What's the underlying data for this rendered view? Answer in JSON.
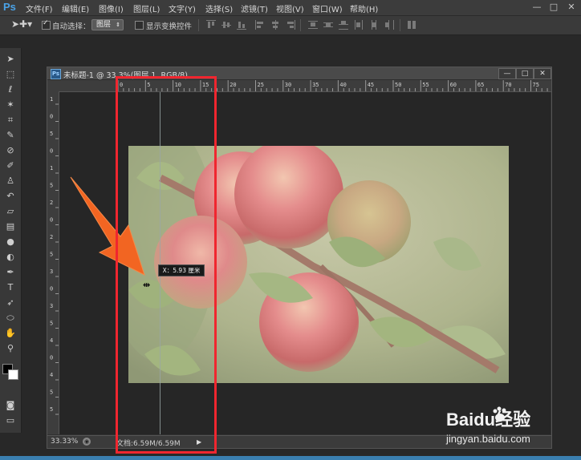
{
  "app": {
    "logo": "Ps",
    "menu": [
      "文件(F)",
      "编辑(E)",
      "图像(I)",
      "图层(L)",
      "文字(Y)",
      "选择(S)",
      "滤镜(T)",
      "视图(V)",
      "窗口(W)",
      "帮助(H)"
    ],
    "window_controls": [
      "—",
      "□",
      "✕"
    ]
  },
  "options": {
    "auto_select_label": "自动选择：",
    "auto_select_checked": true,
    "auto_select_value": "图层",
    "show_transform_label": "显示变换控件",
    "show_transform_checked": false
  },
  "tools": [
    "move-tool",
    "marquee-tool",
    "lasso-tool",
    "magic-wand-tool",
    "crop-tool",
    "eyedropper-tool",
    "spot-heal-tool",
    "brush-tool",
    "clone-stamp-tool",
    "history-brush-tool",
    "eraser-tool",
    "gradient-tool",
    "blur-tool",
    "dodge-tool",
    "pen-tool",
    "type-tool",
    "path-select-tool",
    "shape-tool",
    "hand-tool",
    "zoom-tool"
  ],
  "document": {
    "icon": "Ps",
    "title": "未标题-1 @ 33.3%(图层 1, RGB/8)",
    "controls": [
      "—",
      "□",
      "✕"
    ],
    "ruler_top": [
      "0",
      "5",
      "10",
      "15",
      "20",
      "25",
      "30",
      "35",
      "40",
      "45",
      "50",
      "55",
      "60",
      "65",
      "70",
      "75"
    ],
    "ruler_left": [
      "1",
      "0",
      "5",
      "0",
      "1",
      "5",
      "2",
      "0",
      "2",
      "5",
      "3",
      "0",
      "3",
      "5",
      "4",
      "0",
      "4",
      "5",
      "5"
    ],
    "zoom": "33.33%",
    "doc_size": "文档:6.59M/6.59M",
    "guide_tooltip": "X：5.93 厘米"
  },
  "watermark": {
    "brand": "Baidu经验",
    "url": "jingyan.baidu.com"
  },
  "colors": {
    "highlight": "#f0262f",
    "arrow": "#f26522",
    "ps_blue": "#4aa3e8"
  }
}
